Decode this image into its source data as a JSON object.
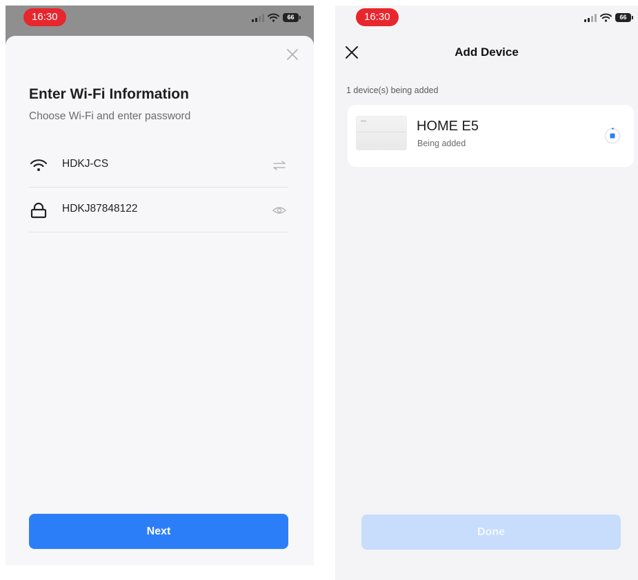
{
  "colors": {
    "accent": "#2c7ef8",
    "accent_disabled": "#c8dcfb",
    "time_pill": "#e8262d",
    "dim_overlay": "#8f8f8f"
  },
  "left_screen": {
    "status_bar": {
      "time": "16:30",
      "battery": "66"
    },
    "sheet": {
      "close_icon": "close-icon",
      "title": "Enter Wi-Fi Information",
      "subtitle": "Choose Wi-Fi and enter password",
      "wifi_field": {
        "icon": "wifi-icon",
        "value": "HDKJ-CS",
        "action_icon": "swap-icon"
      },
      "password_field": {
        "icon": "lock-icon",
        "value": "HDKJ87848122",
        "action_icon": "eye-icon"
      },
      "next_label": "Next"
    }
  },
  "right_screen": {
    "status_bar": {
      "time": "16:30",
      "battery": "66"
    },
    "nav": {
      "close_icon": "close-icon",
      "title": "Add Device"
    },
    "count_label": "1 device(s) being added",
    "device": {
      "name": "HOME E5",
      "status": "Being added",
      "progress_icon": "spinner-stop-icon"
    },
    "done_label": "Done"
  }
}
